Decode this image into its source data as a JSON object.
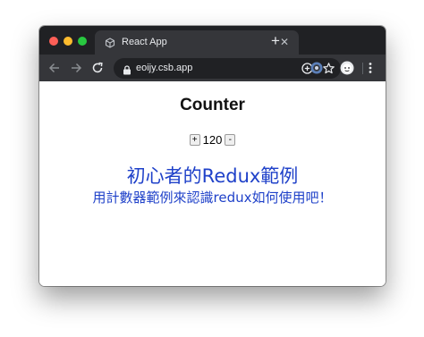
{
  "browser": {
    "tab": {
      "title": "React App",
      "favicon": "codesandbox-cube-icon"
    },
    "address_bar": {
      "url": "eoijy.csb.app"
    },
    "colors": {
      "tabstrip": "#202124",
      "toolbar": "#35363a",
      "omnibox": "#202124"
    }
  },
  "page": {
    "heading": "Counter",
    "counter": {
      "increment_label": "+",
      "value": "120",
      "decrement_label": "-"
    },
    "title": "初心者的Redux範例",
    "subtitle": "用計數器範例來認識redux如何使用吧！",
    "accent_color": "#1f41c9"
  }
}
